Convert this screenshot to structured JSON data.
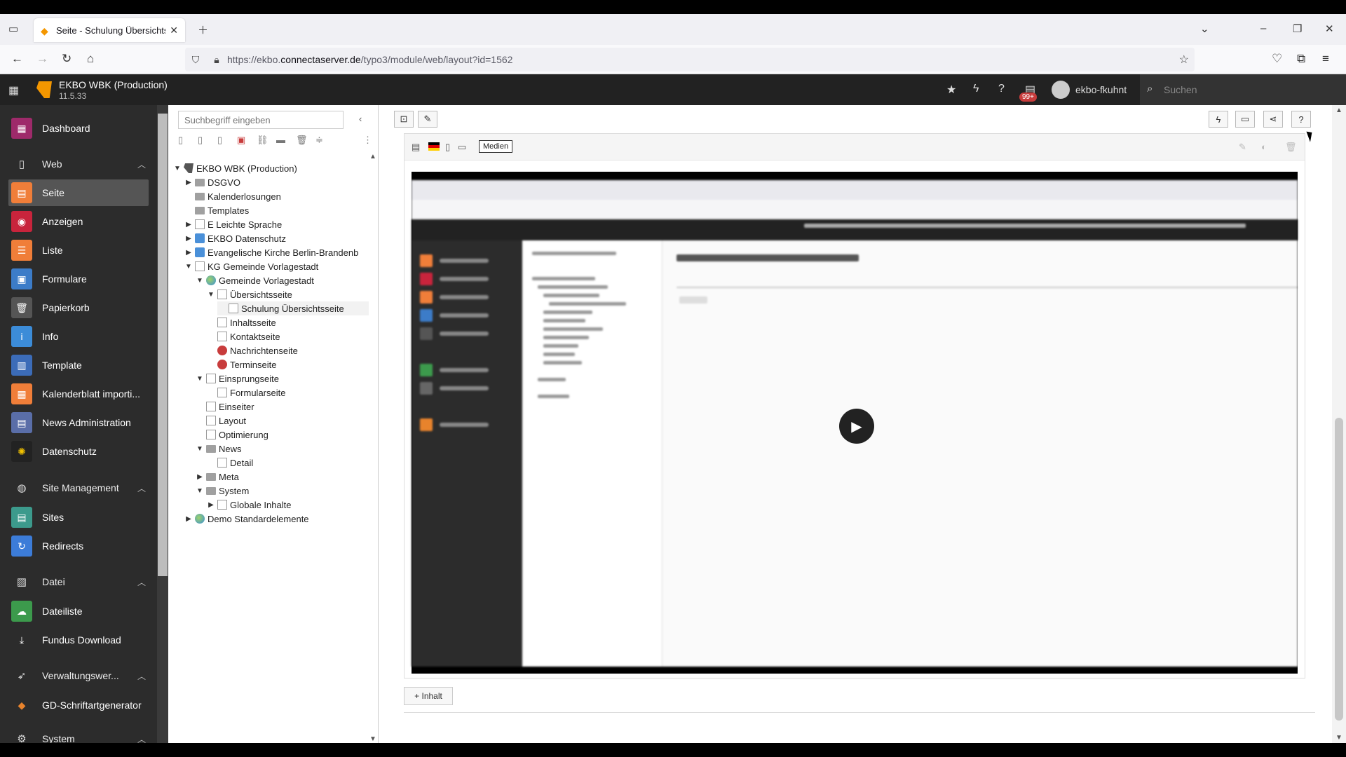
{
  "browser": {
    "tab_title": "Seite - Schulung Übersichtsseit",
    "url_prefix": "https://ekbo.",
    "url_host": "connectaserver.de",
    "url_path": "/typo3/module/web/layout?id=1562"
  },
  "topbar": {
    "site_name": "EKBO WBK (Production)",
    "version": "11.5.33",
    "notification_badge": "99+",
    "username": "ekbo-fkuhnt",
    "search_placeholder": "Suchen"
  },
  "modules": {
    "dashboard": "Dashboard",
    "group_web": "Web",
    "seite": "Seite",
    "anzeigen": "Anzeigen",
    "liste": "Liste",
    "formulare": "Formulare",
    "papierkorb": "Papierkorb",
    "info": "Info",
    "template": "Template",
    "kalenderblatt": "Kalenderblatt importi...",
    "news_admin": "News Administration",
    "datenschutz": "Datenschutz",
    "group_site": "Site Management",
    "sites": "Sites",
    "redirects": "Redirects",
    "group_datei": "Datei",
    "dateiliste": "Dateiliste",
    "fundus": "Fundus Download",
    "group_verwaltung": "Verwaltungswer...",
    "gd_schrift": "GD-Schriftartgenerator",
    "group_system": "System"
  },
  "tree": {
    "search_placeholder": "Suchbegriff eingeben",
    "nodes": [
      "EKBO WBK (Production)",
      "DSGVO",
      "Kalenderlosungen",
      "Templates",
      "E Leichte Sprache",
      "EKBO Datenschutz",
      "Evangelische Kirche Berlin-Brandenb",
      "KG Gemeinde Vorlagestadt",
      "Gemeinde Vorlagestadt",
      "Übersichtsseite",
      "Schulung Übersichtsseite",
      "Inhaltsseite",
      "Kontaktseite",
      "Nachrichtenseite",
      "Terminseite",
      "Einsprungseite",
      "Formularseite",
      "Einseiter",
      "Layout",
      "Optimierung",
      "News",
      "Detail",
      "Meta",
      "System",
      "Globale Inhalte",
      "Demo Standardelemente"
    ]
  },
  "content": {
    "ctype_label": "Medien",
    "add_content_label": "Inhalt"
  },
  "colors": {
    "typo3_orange": "#f49700",
    "topbar_bg": "#222222",
    "module_bg": "#2c2c2c"
  }
}
